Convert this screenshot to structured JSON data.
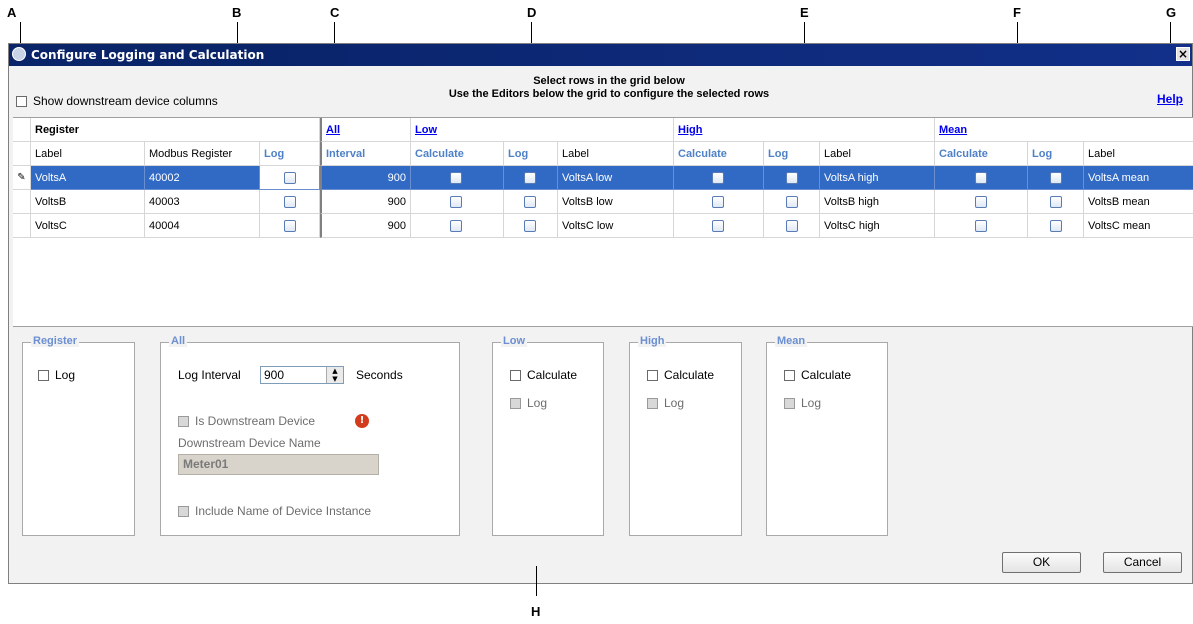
{
  "callouts": {
    "a": "A",
    "b": "B",
    "c": "C",
    "d": "D",
    "e": "E",
    "f": "F",
    "g": "G",
    "h": "H"
  },
  "window": {
    "title": "Configure Logging and Calculation",
    "close_glyph": "×"
  },
  "top": {
    "show_downstream_label": "Show downstream device columns",
    "instruction_line1": "Select rows in the grid below",
    "instruction_line2": "Use the Editors below the grid to configure the selected rows",
    "help_label": "Help"
  },
  "grid": {
    "groups": {
      "register": "Register",
      "all": "All",
      "low": "Low",
      "high": "High",
      "mean": "Mean"
    },
    "columns": {
      "label": "Label",
      "modbus": "Modbus Register",
      "log": "Log",
      "interval": "Interval",
      "low_calc": "Calculate",
      "low_log": "Log",
      "low_label": "Label",
      "high_calc": "Calculate",
      "high_log": "Log",
      "high_label": "Label",
      "mean_calc": "Calculate",
      "mean_log": "Log",
      "mean_label": "Label"
    },
    "rows": [
      {
        "label": "VoltsA",
        "modbus": "40002",
        "interval": "900",
        "low_label": "VoltsA low",
        "high_label": "VoltsA high",
        "mean_label": "VoltsA mean",
        "selected": true
      },
      {
        "label": "VoltsB",
        "modbus": "40003",
        "interval": "900",
        "low_label": "VoltsB low",
        "high_label": "VoltsB high",
        "mean_label": "VoltsB mean",
        "selected": false
      },
      {
        "label": "VoltsC",
        "modbus": "40004",
        "interval": "900",
        "low_label": "VoltsC low",
        "high_label": "VoltsC high",
        "mean_label": "VoltsC mean",
        "selected": false
      }
    ]
  },
  "editors": {
    "register": {
      "title": "Register",
      "log": "Log"
    },
    "all": {
      "title": "All",
      "log_interval_label": "Log Interval",
      "log_interval_value": "900",
      "seconds": "Seconds",
      "is_downstream": "Is Downstream Device",
      "downstream_name_label": "Downstream Device Name",
      "downstream_name_value": "Meter01",
      "include_name": "Include Name of Device Instance"
    },
    "low": {
      "title": "Low",
      "calculate": "Calculate",
      "log": "Log"
    },
    "high": {
      "title": "High",
      "calculate": "Calculate",
      "log": "Log"
    },
    "mean": {
      "title": "Mean",
      "calculate": "Calculate",
      "log": "Log"
    }
  },
  "buttons": {
    "ok": "OK",
    "cancel": "Cancel"
  }
}
